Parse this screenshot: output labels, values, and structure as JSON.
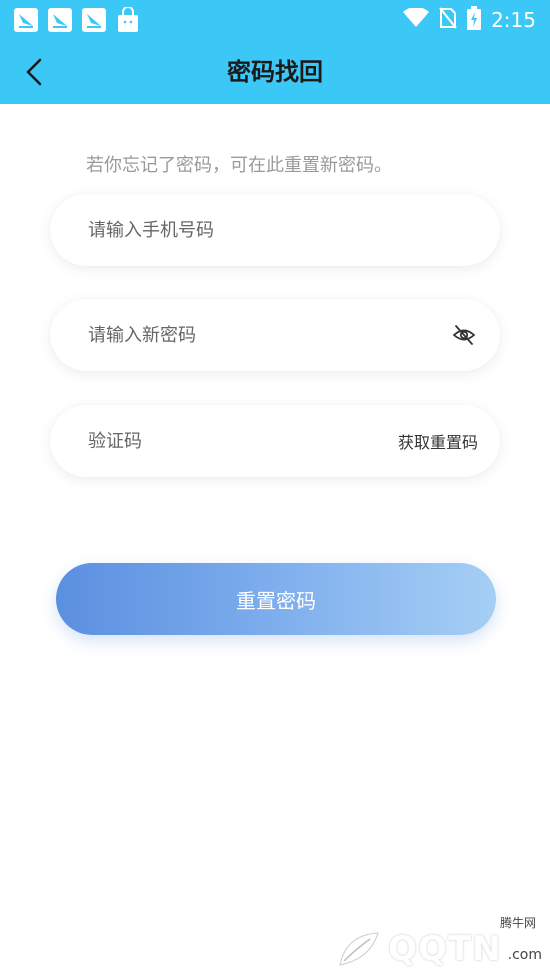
{
  "status_bar": {
    "time": "2:15",
    "notification_icons": [
      "app-notification-icon",
      "app-notification-icon",
      "app-notification-icon",
      "shopping-bag-icon"
    ],
    "status_icons": [
      "wifi-icon",
      "no-sim-icon",
      "battery-charging-icon"
    ]
  },
  "header": {
    "title": "密码找回",
    "back_icon": "back-arrow-icon"
  },
  "form": {
    "hint": "若你忘记了密码，可在此重置新密码。",
    "phone_placeholder": "请输入手机号码",
    "password_placeholder": "请输入新密码",
    "code_placeholder": "验证码",
    "get_code_label": "获取重置码",
    "submit_label": "重置密码"
  },
  "watermark": {
    "brand": "QQTN",
    "suffix": ".com",
    "site_name": "腾牛网"
  },
  "colors": {
    "primary": "#3cc8f7",
    "button_start": "#5b8fe0",
    "button_end": "#a6cff5"
  }
}
